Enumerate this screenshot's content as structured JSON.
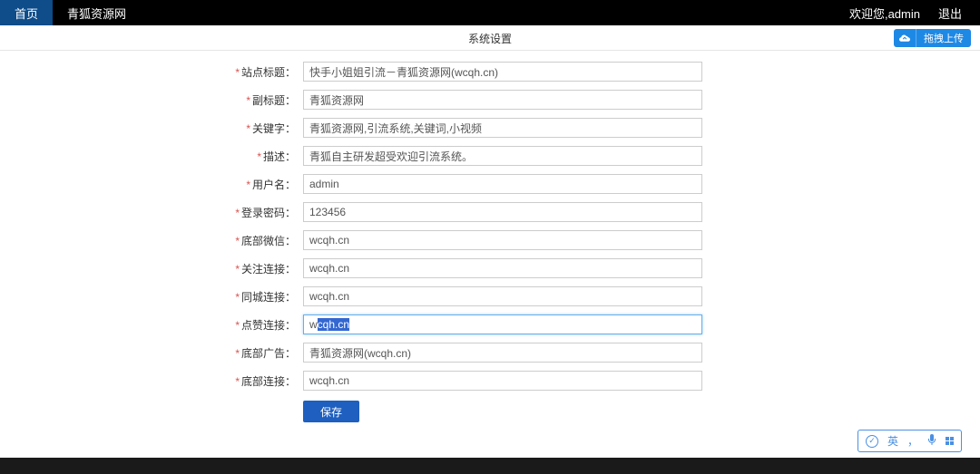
{
  "topbar": {
    "home": "首页",
    "brand": "青狐资源网",
    "welcome": "欢迎您,admin",
    "logout": "退出"
  },
  "header": {
    "title": "系统设置",
    "upload_label": "拖拽上传"
  },
  "form": {
    "fields": [
      {
        "label": "站点标题：",
        "value": "快手小姐姐引流－青狐资源网(wcqh.cn)",
        "required": true
      },
      {
        "label": "副标题：",
        "value": "青狐资源网",
        "required": true
      },
      {
        "label": "关键字：",
        "value": "青狐资源网,引流系统,关键词,小视频",
        "required": true
      },
      {
        "label": "描述：",
        "value": "青狐自主研发超受欢迎引流系统。",
        "required": true
      },
      {
        "label": "用户名：",
        "value": "admin",
        "required": true
      },
      {
        "label": "登录密码：",
        "value": "123456",
        "required": true
      },
      {
        "label": "底部微信：",
        "value": "wcqh.cn",
        "required": true
      },
      {
        "label": "关注连接：",
        "value": "wcqh.cn",
        "required": true
      },
      {
        "label": "同城连接：",
        "value": "wcqh.cn",
        "required": true
      },
      {
        "label": "点赞连接：",
        "value": "wcqh.cn",
        "required": true,
        "focused": true
      },
      {
        "label": "底部广告：",
        "value": "青狐资源网(wcqh.cn)",
        "required": true
      },
      {
        "label": "底部连接：",
        "value": "wcqh.cn",
        "required": true
      }
    ],
    "save": "保存"
  },
  "ime": {
    "lang": "英",
    "punct": "，"
  },
  "statusbar": {
    "text": ""
  }
}
